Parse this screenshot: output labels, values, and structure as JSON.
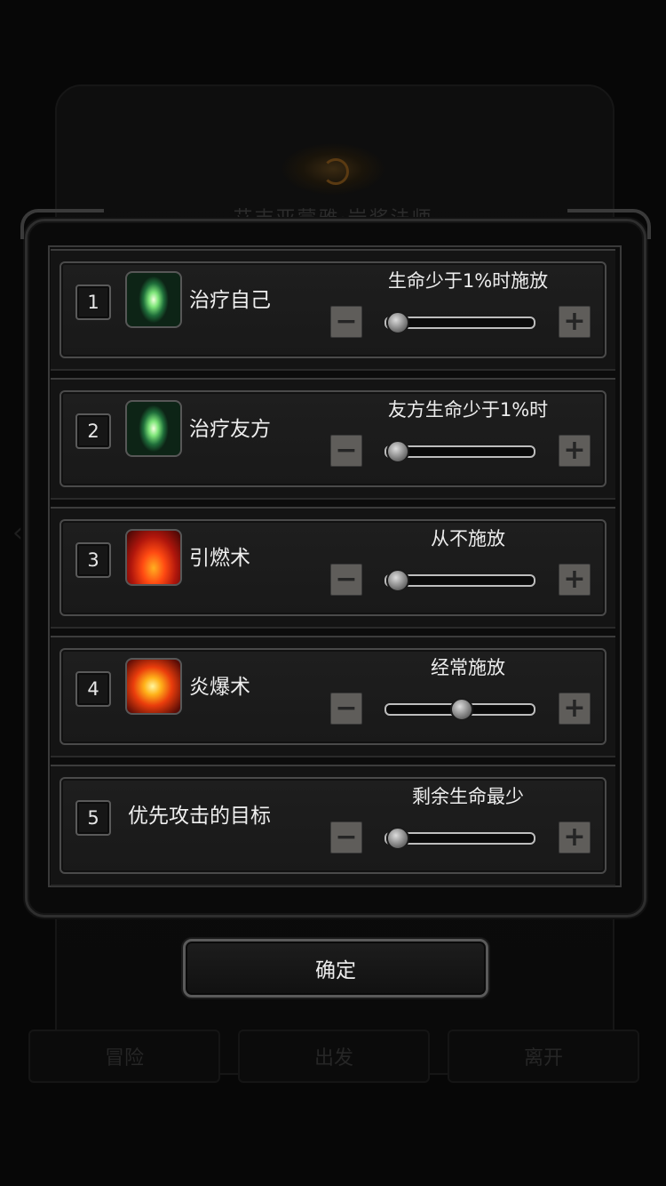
{
  "background": {
    "title": "艾吉亚蒙雅·岩浆法师",
    "bottom_buttons": [
      "冒险",
      "出发",
      "离开"
    ]
  },
  "skills": [
    {
      "number": "1",
      "name": "治疗自己",
      "icon": "heal-icon",
      "condition": "生命少于1%时施放",
      "slider_value": 0.0
    },
    {
      "number": "2",
      "name": "治疗友方",
      "icon": "heal-icon",
      "condition": "友方生命少于1%时",
      "slider_value": 0.0
    },
    {
      "number": "3",
      "name": "引燃术",
      "icon": "fire-icon",
      "condition": "从不施放",
      "slider_value": 0.0
    },
    {
      "number": "4",
      "name": "炎爆术",
      "icon": "burst-icon",
      "condition": "经常施放",
      "slider_value": 0.5
    },
    {
      "number": "5",
      "name": "优先攻击的目标",
      "icon": "",
      "condition": "剩余生命最少",
      "slider_value": 0.0
    }
  ],
  "controls": {
    "minus_symbol": "−",
    "plus_symbol": "+"
  },
  "confirm_label": "确定"
}
